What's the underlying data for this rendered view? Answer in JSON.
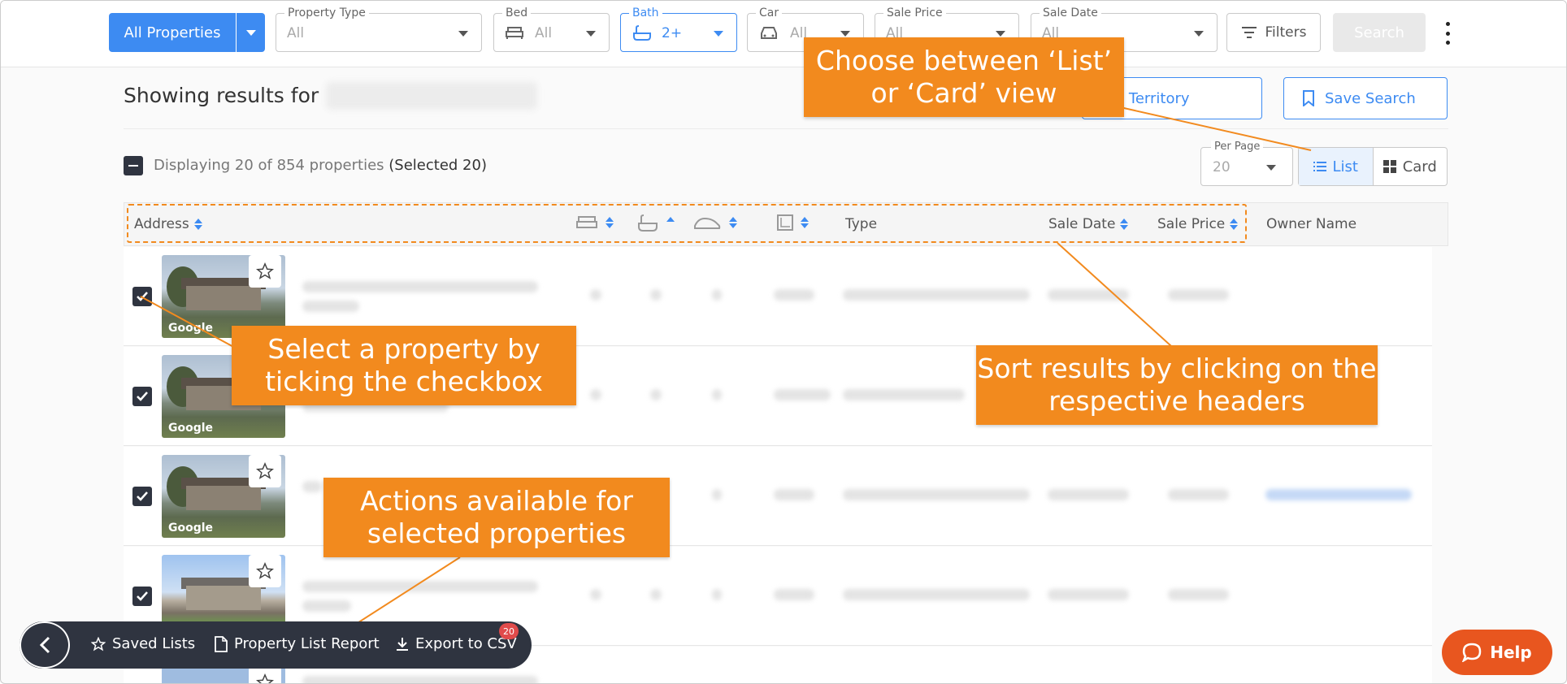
{
  "topbar": {
    "all_properties": "All Properties",
    "property_type": {
      "label": "Property Type",
      "value": "All"
    },
    "bed": {
      "label": "Bed",
      "value": "All"
    },
    "bath": {
      "label": "Bath",
      "value": "2+"
    },
    "car": {
      "label": "Car",
      "value": "All"
    },
    "sale_price": {
      "label": "Sale Price",
      "value": "All"
    },
    "sale_date": {
      "label": "Sale Date",
      "value": "All"
    },
    "filters": "Filters",
    "search": "Search"
  },
  "results": {
    "title": "Showing results for",
    "territory_button": "ate Territory",
    "save_search": "Save Search",
    "display_text": "Displaying 20 of 854 properties",
    "selected_text": "(Selected 20)",
    "per_page_label": "Per Page",
    "per_page_value": "20",
    "view_list": "List",
    "view_card": "Card"
  },
  "table": {
    "columns": {
      "address": "Address",
      "type": "Type",
      "sale_date": "Sale Date",
      "sale_price": "Sale Price",
      "owner_name": "Owner Name"
    },
    "google_label": "Google"
  },
  "callouts": {
    "view": "Choose between ‘List’ or ‘Card’ view",
    "select": "Select a property by ticking the checkbox",
    "sort": "Sort results by clicking on the respective headers",
    "actions": "Actions available for selected properties"
  },
  "bottombar": {
    "saved_lists": "Saved Lists",
    "report": "Property List Report",
    "export": "Export to CSV",
    "badge": "20"
  },
  "help": "Help",
  "colors": {
    "accent": "#3d8bf2",
    "callout": "#f28a1e",
    "help": "#e8561f",
    "dark": "#2f3440"
  }
}
